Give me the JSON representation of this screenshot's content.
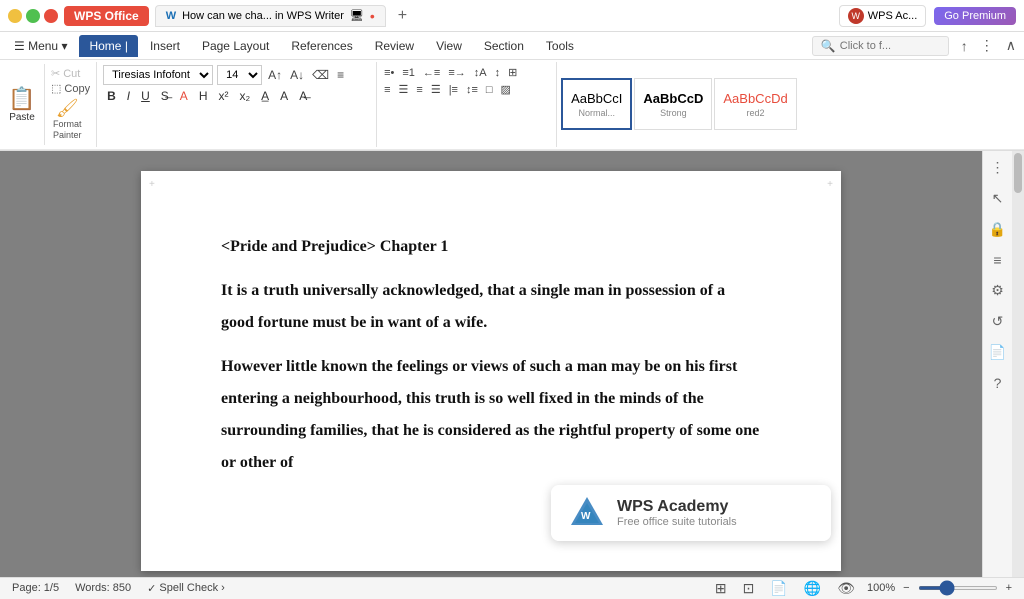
{
  "titlebar": {
    "wps_label": "WPS Office",
    "tab_title": "How can we cha... in WPS Writer",
    "profile_label": "WPS Ac...",
    "premium_label": "Go Premium"
  },
  "ribbon": {
    "tabs": [
      "Menu ▾",
      "Home |",
      "Insert",
      "Page Layout",
      "References",
      "Review",
      "View",
      "Section",
      "Tools"
    ],
    "active_tab": "Home |",
    "search_placeholder": "Click to f...",
    "font_name": "Tiresias Infofont",
    "font_size": "14",
    "style_items": [
      {
        "label": "Normal...",
        "preview": "AaBbCcl",
        "type": "normal"
      },
      {
        "label": "Strong",
        "preview": "AaBbCcD",
        "type": "strong"
      },
      {
        "label": "red2",
        "preview": "AaBbCcDd",
        "type": "red"
      }
    ]
  },
  "clipboard": {
    "paste_label": "Paste",
    "cut_label": "Cut",
    "copy_label": "Copy",
    "format_painter_label": "Format\nPainter"
  },
  "document": {
    "title": "<Pride and Prejudice> Chapter 1",
    "paragraphs": [
      "It is a truth universally acknowledged, that a single man in possession of a good fortune must be in want of a wife.",
      "However little known the feelings or views of such a man may be on his first entering a neighbourhood, this truth is so well fixed in the minds of the surrounding families, that he is considered as the rightful property of some one or other of"
    ]
  },
  "statusbar": {
    "page": "Page: 1/5",
    "words": "Words: 850",
    "spell_check": "Spell Check",
    "zoom": "100%"
  },
  "academy": {
    "title": "WPS Academy",
    "subtitle": "Free office suite tutorials"
  }
}
